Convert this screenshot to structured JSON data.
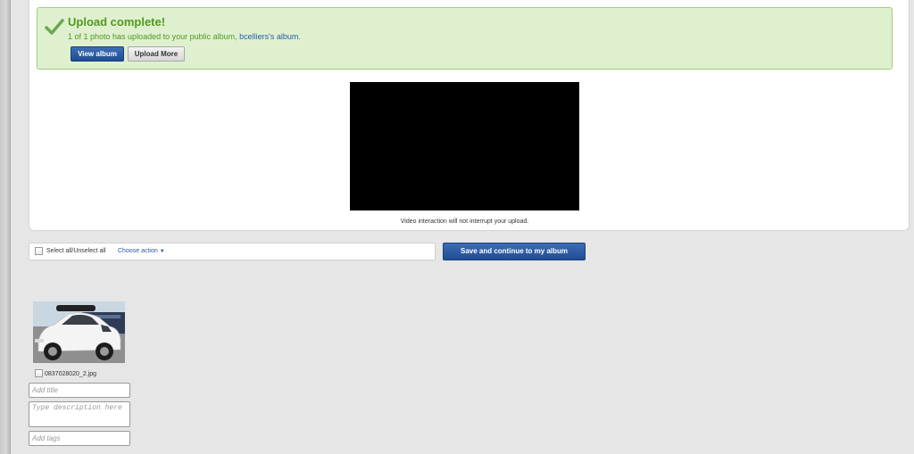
{
  "notification": {
    "title": "Upload complete!",
    "message_prefix": "1 of 1 photo has uploaded to your public album, ",
    "album_link": "bcelliers's album",
    "message_suffix": ".",
    "view_album_label": "View album",
    "upload_more_label": "Upload More",
    "icon": "checkmark-icon",
    "color": "#4f9a1e"
  },
  "video": {
    "note": "Video interaction will not interrupt your upload."
  },
  "actionbar": {
    "select_all_label": "Select all/Unselect all",
    "choose_action_label": "Choose action",
    "choose_action_icon": "▼",
    "save_label": "Save and continue to my album"
  },
  "photos": [
    {
      "filename": "0837028020_2.jpg",
      "title_placeholder": "Add title",
      "description_placeholder": "Type description here",
      "tags_placeholder": "Add tags"
    }
  ],
  "colors": {
    "primary_button": "#1f4d94",
    "success_bg": "#dff0cf",
    "link": "#2a5ba8"
  }
}
